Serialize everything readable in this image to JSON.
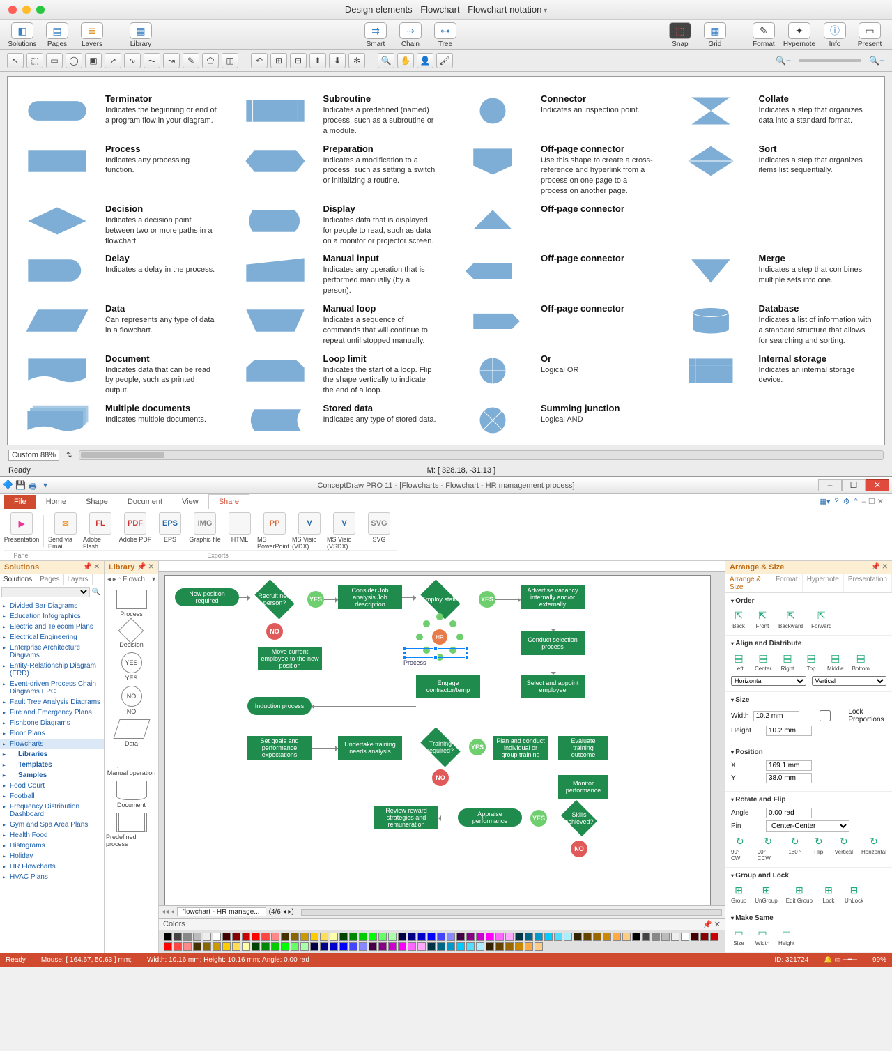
{
  "mac": {
    "title": "Design elements - Flowchart - Flowchart notation",
    "toolbar": [
      "Solutions",
      "Pages",
      "Layers",
      "Library",
      "Smart",
      "Chain",
      "Tree",
      "Snap",
      "Grid",
      "Format",
      "Hypernote",
      "Info",
      "Present"
    ],
    "zoom_label": "Custom 88%",
    "ready": "Ready",
    "status_coords": "M: [ 328.18, -31.13 ]",
    "legend": [
      {
        "t": "Terminator",
        "d": "Indicates the beginning or end of a program flow in your diagram.",
        "s": "terminator"
      },
      {
        "t": "Subroutine",
        "d": "Indicates a predefined (named) process, such as a subroutine or a module.",
        "s": "subroutine"
      },
      {
        "t": "Connector",
        "d": "Indicates an inspection point.",
        "s": "connector"
      },
      {
        "t": "Collate",
        "d": "Indicates a step that organizes data into a standard format.",
        "s": "collate"
      },
      {
        "t": "Process",
        "d": "Indicates any processing function.",
        "s": "process"
      },
      {
        "t": "Preparation",
        "d": "Indicates a modification to a process, such as setting a switch or initializing a routine.",
        "s": "preparation"
      },
      {
        "t": "Off-page connector",
        "d": "Use this shape to create a cross-reference and hyperlink from a process on one page to a process on another page.",
        "s": "offpage1"
      },
      {
        "t": "Sort",
        "d": "Indicates a step that organizes items list sequentially.",
        "s": "sort"
      },
      {
        "t": "Decision",
        "d": "Indicates a decision point between two or more paths in a flowchart.",
        "s": "decision"
      },
      {
        "t": "Display",
        "d": "Indicates data that is displayed for people to read, such as data on a monitor or projector screen.",
        "s": "display"
      },
      {
        "t": "Off-page connector",
        "d": "",
        "s": "offpage2"
      },
      {
        "t": "",
        "d": "",
        "s": "blank"
      },
      {
        "t": "Delay",
        "d": "Indicates a delay in the process.",
        "s": "delay"
      },
      {
        "t": "Manual input",
        "d": "Indicates any operation that is performed manually (by a person).",
        "s": "manualinput"
      },
      {
        "t": "Off-page connector",
        "d": "",
        "s": "offpage3"
      },
      {
        "t": "Merge",
        "d": "Indicates a step that combines multiple sets into one.",
        "s": "merge"
      },
      {
        "t": "Data",
        "d": "Can represents any type of data in a flowchart.",
        "s": "data"
      },
      {
        "t": "Manual loop",
        "d": "Indicates a sequence of commands that will continue to repeat until stopped manually.",
        "s": "manualloop"
      },
      {
        "t": "Off-page connector",
        "d": "",
        "s": "offpage4"
      },
      {
        "t": "Database",
        "d": "Indicates a list of information with a standard structure that allows for searching and sorting.",
        "s": "database"
      },
      {
        "t": "Document",
        "d": "Indicates data that can be read by people, such as printed output.",
        "s": "document"
      },
      {
        "t": "Loop limit",
        "d": "Indicates the start of a loop. Flip the shape vertically to indicate the end of a loop.",
        "s": "looplimit"
      },
      {
        "t": "Or",
        "d": "Logical OR",
        "s": "or"
      },
      {
        "t": "Internal storage",
        "d": "Indicates an internal storage device.",
        "s": "internalstorage"
      },
      {
        "t": "Multiple documents",
        "d": "Indicates multiple documents.",
        "s": "multipledocs"
      },
      {
        "t": "Stored data",
        "d": "Indicates any type of stored data.",
        "s": "storeddata"
      },
      {
        "t": "Summing junction",
        "d": "Logical AND",
        "s": "summing"
      },
      {
        "t": "",
        "d": "",
        "s": "blank"
      }
    ]
  },
  "win": {
    "title": "ConceptDraw PRO 11 - [Flowcharts - Flowchart - HR management process]",
    "file_tab": "File",
    "tabs": [
      "Home",
      "Shape",
      "Document",
      "View",
      "Share"
    ],
    "active_tab": "Share",
    "ribbon": {
      "panel_label": "Panel",
      "exports_label": "Exports",
      "items": [
        "Presentation",
        "Send via Email",
        "Adobe Flash",
        "Adobe PDF",
        "EPS",
        "Graphic file",
        "HTML",
        "MS PowerPoint",
        "MS Visio (VDX)",
        "MS Visio (VSDX)",
        "SVG"
      ],
      "icons": [
        "▶",
        "✉",
        "FL",
        "PDF",
        "EPS",
        "IMG",
        "</>",
        "PP",
        "V",
        "V",
        "SVG"
      ]
    },
    "solutions": {
      "title": "Solutions",
      "tabs": [
        "Solutions",
        "Pages",
        "Layers"
      ],
      "items": [
        "Divided Bar Diagrams",
        "Education Infographics",
        "Electric and Telecom Plans",
        "Electrical Engineering",
        "Enterprise Architecture Diagrams",
        "Entity-Relationship Diagram (ERD)",
        "Event-driven Process Chain Diagrams EPC",
        "Fault Tree Analysis Diagrams",
        "Fire and Emergency Plans",
        "Fishbone Diagrams",
        "Floor Plans",
        "Flowcharts",
        "Food Court",
        "Football",
        "Frequency Distribution Dashboard",
        "Gym and Spa Area Plans",
        "Health Food",
        "Histograms",
        "Holiday",
        "HR Flowcharts",
        "HVAC Plans"
      ],
      "subitems": [
        "Libraries",
        "Templates",
        "Samples"
      ],
      "selected": "Flowcharts"
    },
    "library": {
      "title": "Library",
      "dropdown": "Flowch...",
      "items": [
        "Process",
        "Decision",
        "YES",
        "NO",
        "Data",
        "Manual operation",
        "Document",
        "Predefined process"
      ]
    },
    "canvas": {
      "sheet_tab": "'lowchart - HR manage...",
      "sheet_nav": "(4/6  ◂ ▸)",
      "selected_label": "Process",
      "nodes": {
        "n1": "New position required",
        "n2": "Recruit new person?",
        "n3": "Consider Job analysis Job description",
        "n4": "Employ staff?",
        "n5": "Advertise vacancy internally and/or externally",
        "n6": "Move current employee to the new position",
        "n7": "Conduct selection process",
        "n8": "Engage contractor/temp",
        "n9": "Select and appoint employee",
        "n10": "Induction process",
        "n11": "Set goals and performance expectations",
        "n12": "Undertake training needs analysis",
        "n13": "Training required?",
        "n14": "Plan and conduct individual or group training",
        "n15": "Evaluate training outcome",
        "n16": "Monitor performance",
        "n17": "Review reward strategies and remuneration",
        "n18": "Appraise performance",
        "n19": "Skills achieved?",
        "hr": "HR",
        "yes": "YES",
        "no": "NO"
      }
    },
    "colors_title": "Colors",
    "arrange": {
      "title": "Arrange & Size",
      "tabs": [
        "Arrange & Size",
        "Format",
        "Hypernote",
        "Presentation"
      ],
      "order": {
        "h": "Order",
        "items": [
          "Back",
          "Front",
          "Backward",
          "Forward"
        ]
      },
      "align": {
        "h": "Align and Distribute",
        "row1": [
          "Left",
          "Center",
          "Right",
          "Top",
          "Middle",
          "Bottom"
        ],
        "hv": [
          "Horizontal",
          "Vertical"
        ]
      },
      "size": {
        "h": "Size",
        "width_l": "Width",
        "width_v": "10.2 mm",
        "height_l": "Height",
        "height_v": "10.2 mm",
        "lock": "Lock Proportions"
      },
      "position": {
        "h": "Position",
        "x_l": "X",
        "x_v": "169.1 mm",
        "y_l": "Y",
        "y_v": "38.0 mm"
      },
      "rotate": {
        "h": "Rotate and Flip",
        "angle_l": "Angle",
        "angle_v": "0.00 rad",
        "pin_l": "Pin",
        "pin_v": "Center-Center",
        "items": [
          "90° CW",
          "90° CCW",
          "180 °",
          "Flip",
          "Vertical",
          "Horizontal"
        ]
      },
      "group": {
        "h": "Group and Lock",
        "items": [
          "Group",
          "UnGroup",
          "Edit Group",
          "Lock",
          "UnLock"
        ]
      },
      "make": {
        "h": "Make Same",
        "items": [
          "Size",
          "Width",
          "Height"
        ]
      }
    },
    "status": {
      "ready": "Ready",
      "mouse": "Mouse: [ 164.67, 50.63 ] mm;",
      "dims": "Width: 10.16 mm;   Height: 10.16 mm;   Angle: 0.00 rad",
      "id": "ID: 321724",
      "zoom": "99%"
    }
  }
}
